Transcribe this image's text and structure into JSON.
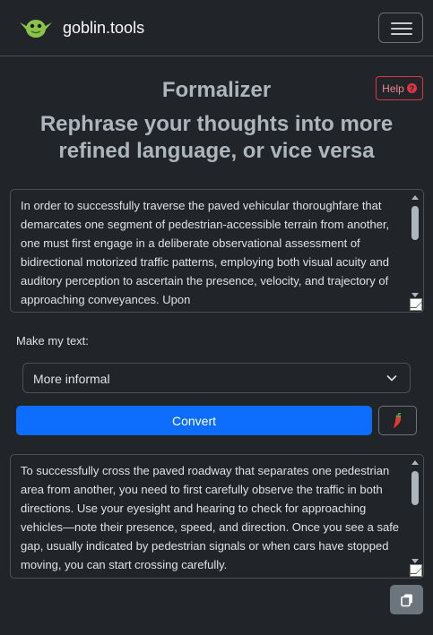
{
  "navbar": {
    "brand": "goblin.tools",
    "logo_icon": "goblin-logo-icon",
    "menu_icon": "hamburger-menu-icon"
  },
  "header": {
    "title": "Formalizer",
    "help_label": "Help",
    "help_icon": "question-circle-icon",
    "subtitle": "Rephrase your thoughts into more refined language, or vice versa"
  },
  "input": {
    "text": "In order to successfully traverse the paved vehicular thoroughfare that demarcates one segment of pedestrian-accessible terrain from another, one must first engage in a deliberate observational assessment of bidirectional motorized traffic patterns, employing both visual acuity and auditory perception to ascertain the presence, velocity, and trajectory of approaching conveyances. Upon"
  },
  "options": {
    "label": "Make my text:",
    "selected": "More informal"
  },
  "actions": {
    "convert_label": "Convert",
    "spicy_icon": "chili-pepper-icon",
    "copy_icon": "copy-icon"
  },
  "output": {
    "text": "To successfully cross the paved roadway that separates one pedestrian area from another, you need to first carefully observe the traffic in both directions. Use your eyesight and hearing to check for approaching vehicles—note their presence, speed, and direction. Once you see a safe gap, usually indicated by pedestrian signals or when cars have stopped moving, you can start crossing carefully."
  },
  "colors": {
    "background": "#212529",
    "primary": "#0d6efd",
    "danger": "#dc3545",
    "goblin_green": "#8bc34a"
  }
}
